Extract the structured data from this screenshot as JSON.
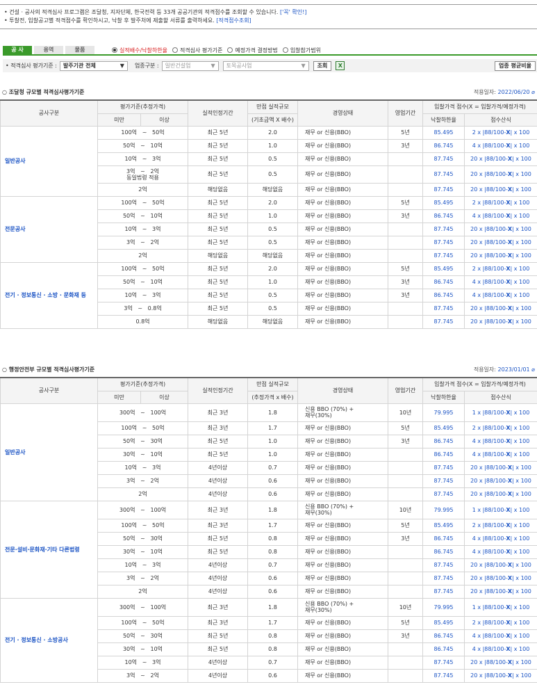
{
  "notice": {
    "line1": "• 건설 · 공사의 적격심사 프로그램은 조달청, 지자단체, 한국전력 등 33개 공공기관의 적격점수를 조회할 수 있습니다.",
    "line1_link": "['꼭' 확인!]",
    "line2": "• 투찰전, 입찰공고별 적격점수를 확인하시고, 낙찰 후 발주처에 제출할 서류를 출력하세요.",
    "line2_link": "[적격점수조회]"
  },
  "tabs": [
    "공 사",
    "용역",
    "물품"
  ],
  "radios": [
    "실적배수/낙찰하한율",
    "적격심사 평가기준",
    "예정가격 결정방법",
    "입찰참가범위"
  ],
  "filter": {
    "label1": "• 적격심사 평가기준 :",
    "sel1": "발주기관 전체",
    "label2": "업종구분 :",
    "sel2": "일반건설업",
    "sel3": "토목공사업",
    "search": "조회",
    "excel_icon": "excel-icon",
    "avg_button": "업종 평균비율"
  },
  "header": {
    "col1": "공사구분",
    "col2": "평가기준(추정가격)",
    "col2a": "미만",
    "col2b": "이상",
    "col3": "실적인정기간",
    "col4": "만점 실적규모",
    "col5": "경영상태",
    "col6": "영업기간",
    "col7": "입찰가격 점수(X = 입찰가격/예정가격)",
    "col7a": "낙찰하한율",
    "col7b": "점수산식"
  },
  "section1": {
    "title": "○ 조달청 규모별 적격심사평가기준",
    "date_label": "적용일자:",
    "date": "2022/06/20",
    "sub4": "(기초금액 X 배수)",
    "groups": [
      {
        "name": "일반공사",
        "rows": [
          [
            "100억",
            "~",
            "50억",
            "최근 5년",
            "2.0",
            "재무 or 신용(BBO)",
            "5년",
            "85.495",
            "2 x |88/100-",
            "X",
            "| x 100"
          ],
          [
            "50억",
            "~",
            "10억",
            "최근 5년",
            "1.0",
            "재무 or 신용(BBO)",
            "3년",
            "86.745",
            "4 x |88/100-",
            "X",
            "| x 100"
          ],
          [
            "10억",
            "~",
            "3억",
            "최근 5년",
            "0.5",
            "재무 or 신용(BBO)",
            "",
            "87.745",
            "20 x |88/100-",
            "X",
            "| x 100"
          ],
          [
            "3억",
            "~",
            "2억\n동일법령 적용",
            "최근 5년",
            "0.5",
            "재무 or 신용(BBO)",
            "",
            "87.745",
            "20 x |88/100-",
            "X",
            "| x 100"
          ],
          [
            "2억",
            "",
            "",
            "해당없음",
            "해당없음",
            "재무 or 신용(BBO)",
            "",
            "87.745",
            "20 x |88/100-",
            "X",
            "| x 100"
          ]
        ]
      },
      {
        "name": "전문공사",
        "rows": [
          [
            "100억",
            "~",
            "50억",
            "최근 5년",
            "2.0",
            "재무 or 신용(BBO)",
            "5년",
            "85.495",
            "2 x |88/100-",
            "X",
            "| x 100"
          ],
          [
            "50억",
            "~",
            "10억",
            "최근 5년",
            "1.0",
            "재무 or 신용(BBO)",
            "3년",
            "86.745",
            "4 x |88/100-",
            "X",
            "| x 100"
          ],
          [
            "10억",
            "~",
            "3억",
            "최근 5년",
            "0.5",
            "재무 or 신용(BBO)",
            "",
            "87.745",
            "20 x |88/100-",
            "X",
            "| x 100"
          ],
          [
            "3억",
            "~",
            "2억",
            "최근 5년",
            "0.5",
            "재무 or 신용(BBO)",
            "",
            "87.745",
            "20 x |88/100-",
            "X",
            "| x 100"
          ],
          [
            "2억",
            "",
            "",
            "해당없음",
            "해당없음",
            "재무 or 신용(BBO)",
            "",
            "87.745",
            "20 x |88/100-",
            "X",
            "| x 100"
          ]
        ]
      },
      {
        "name": "전기 · 정보통신 · 소방 · 문화재 등",
        "rows": [
          [
            "100억",
            "~",
            "50억",
            "최근 5년",
            "2.0",
            "재무 or 신용(BBO)",
            "5년",
            "85.495",
            "2 x |88/100-",
            "X",
            "| x 100"
          ],
          [
            "50억",
            "~",
            "10억",
            "최근 5년",
            "1.0",
            "재무 or 신용(BBO)",
            "3년",
            "86.745",
            "4 x |88/100-",
            "X",
            "| x 100"
          ],
          [
            "10억",
            "~",
            "3억",
            "최근 5년",
            "0.5",
            "재무 or 신용(BBO)",
            "3년",
            "86.745",
            "4 x |88/100-",
            "X",
            "| x 100"
          ],
          [
            "3억",
            "~",
            "0.8억",
            "최근 5년",
            "0.5",
            "재무 or 신용(BBO)",
            "",
            "87.745",
            "20 x |88/100-",
            "X",
            "| x 100"
          ],
          [
            "0.8억",
            "",
            "",
            "해당없음",
            "해당없음",
            "재무 or 신용(BBO)",
            "",
            "87.745",
            "20 x |88/100-",
            "X",
            "| x 100"
          ]
        ]
      }
    ]
  },
  "section2": {
    "title": "○ 행정안전부 규모별 적격심사평가기준",
    "date_label": "적용일자:",
    "date": "2023/01/01",
    "sub4": "(추정가격 x 배수)",
    "groups": [
      {
        "name": "일반공사",
        "rows": [
          [
            "300억",
            "~",
            "100억",
            "최근 3년",
            "1.8",
            "신용 BBO (70%) +\n재무(30%)",
            "10년",
            "79.995",
            "1 x |88/100-",
            "X",
            "| x 100"
          ],
          [
            "100억",
            "~",
            "50억",
            "최근 3년",
            "1.7",
            "재무 or 신용(BBO)",
            "5년",
            "85.495",
            "2 x |88/100-",
            "X",
            "| x 100"
          ],
          [
            "50억",
            "~",
            "30억",
            "최근 5년",
            "1.0",
            "재무 or 신용(BBO)",
            "3년",
            "86.745",
            "4 x |88/100-",
            "X",
            "| x 100"
          ],
          [
            "30억",
            "~",
            "10억",
            "최근 5년",
            "1.0",
            "재무 or 신용(BBO)",
            "",
            "86.745",
            "4 x |88/100-",
            "X",
            "| x 100"
          ],
          [
            "10억",
            "~",
            "3억",
            "4년이상",
            "0.7",
            "재무 or 신용(BBO)",
            "",
            "87.745",
            "20 x |88/100-",
            "X",
            "| x 100"
          ],
          [
            "3억",
            "~",
            "2억",
            "4년이상",
            "0.6",
            "재무 or 신용(BBO)",
            "",
            "87.745",
            "20 x |88/100-",
            "X",
            "| x 100"
          ],
          [
            "2억",
            "",
            "",
            "4년이상",
            "0.6",
            "재무 or 신용(BBO)",
            "",
            "87.745",
            "20 x |88/100-",
            "X",
            "| x 100"
          ]
        ]
      },
      {
        "name": "전문·설비·문화재·기타 다른법령",
        "rows": [
          [
            "300억",
            "~",
            "100억",
            "최근 3년",
            "1.8",
            "신용 BBO (70%) +\n재무(30%)",
            "10년",
            "79.995",
            "1 x |88/100-",
            "X",
            "| x 100"
          ],
          [
            "100억",
            "~",
            "50억",
            "최근 3년",
            "1.7",
            "재무 or 신용(BBO)",
            "5년",
            "85.495",
            "2 x |88/100-",
            "X",
            "| x 100"
          ],
          [
            "50억",
            "~",
            "30억",
            "최근 5년",
            "0.8",
            "재무 or 신용(BBO)",
            "3년",
            "86.745",
            "4 x |88/100-",
            "X",
            "| x 100"
          ],
          [
            "30억",
            "~",
            "10억",
            "최근 5년",
            "0.8",
            "재무 or 신용(BBO)",
            "",
            "86.745",
            "4 x |88/100-",
            "X",
            "| x 100"
          ],
          [
            "10억",
            "~",
            "3억",
            "4년이상",
            "0.7",
            "재무 or 신용(BBO)",
            "",
            "87.745",
            "20 x |88/100-",
            "X",
            "| x 100"
          ],
          [
            "3억",
            "~",
            "2억",
            "4년이상",
            "0.6",
            "재무 or 신용(BBO)",
            "",
            "87.745",
            "20 x |88/100-",
            "X",
            "| x 100"
          ],
          [
            "2억",
            "",
            "",
            "4년이상",
            "0.6",
            "재무 or 신용(BBO)",
            "",
            "87.745",
            "20 x |88/100-",
            "X",
            "| x 100"
          ]
        ]
      },
      {
        "name": "전기 · 정보통신 · 소방공사",
        "rows": [
          [
            "300억",
            "~",
            "100억",
            "최근 3년",
            "1.8",
            "신용 BBO (70%) +\n재무(30%)",
            "10년",
            "79.995",
            "1 x |88/100-",
            "X",
            "| x 100"
          ],
          [
            "100억",
            "~",
            "50억",
            "최근 3년",
            "1.7",
            "재무 or 신용(BBO)",
            "5년",
            "85.495",
            "2 x |88/100-",
            "X",
            "| x 100"
          ],
          [
            "50억",
            "~",
            "30억",
            "최근 5년",
            "0.8",
            "재무 or 신용(BBO)",
            "3년",
            "86.745",
            "4 x |88/100-",
            "X",
            "| x 100"
          ],
          [
            "30억",
            "~",
            "10억",
            "최근 5년",
            "0.8",
            "재무 or 신용(BBO)",
            "",
            "86.745",
            "4 x |88/100-",
            "X",
            "| x 100"
          ],
          [
            "10억",
            "~",
            "3억",
            "4년이상",
            "0.7",
            "재무 or 신용(BBO)",
            "",
            "87.745",
            "20 x |88/100-",
            "X",
            "| x 100"
          ],
          [
            "3억",
            "~",
            "2억",
            "4년이상",
            "0.6",
            "재무 or 신용(BBO)",
            "",
            "87.745",
            "20 x |88/100-",
            "X",
            "| x 100"
          ]
        ]
      }
    ]
  }
}
